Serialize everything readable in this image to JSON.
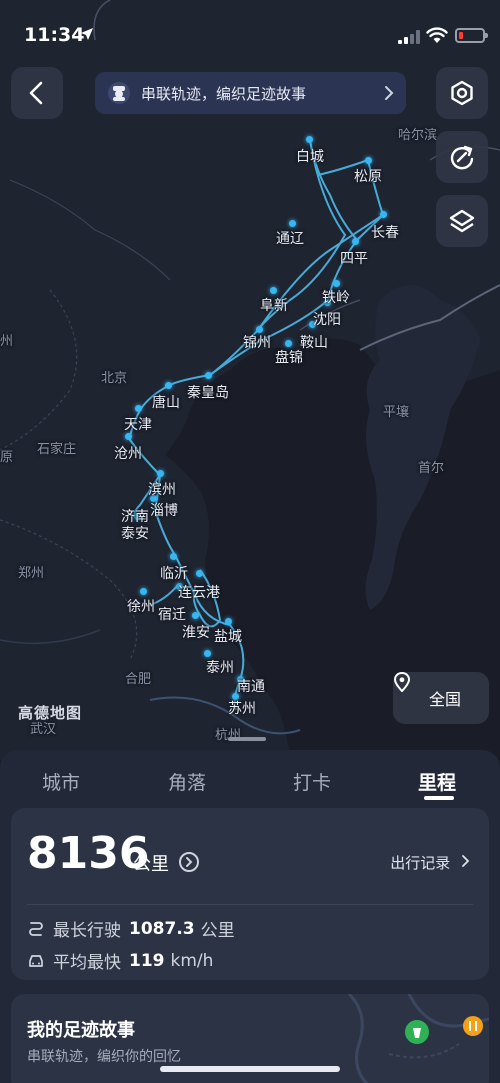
{
  "status_bar": {
    "time": "11:34"
  },
  "top": {
    "story_banner": "串联轨迹，编织足迹故事"
  },
  "map": {
    "watermark": "高德地图",
    "whole_country_label": "全国",
    "visited_cities": [
      "白城",
      "松原",
      "长春",
      "通辽",
      "四平",
      "铁岭",
      "阜新",
      "沈阳",
      "锦州",
      "鞍山",
      "盘锦",
      "秦皇岛",
      "唐山",
      "天津",
      "沧州",
      "滨州",
      "淄博",
      "济南",
      "泰安",
      "临沂",
      "连云港",
      "徐州",
      "宿迁",
      "淮安",
      "盐城",
      "泰州",
      "南通",
      "苏州"
    ],
    "other_labels": [
      "哈尔滨",
      "北京",
      "石家庄",
      "平壤",
      "首尔",
      "郑州",
      "合肥",
      "杭州",
      "武汉",
      "原",
      "州"
    ]
  },
  "panel": {
    "tabs": [
      {
        "label": "城市",
        "active": false
      },
      {
        "label": "角落",
        "active": false
      },
      {
        "label": "打卡",
        "active": false
      },
      {
        "label": "里程",
        "active": true
      }
    ],
    "mileage": {
      "total": "8136",
      "unit": "公里",
      "trip_record_label": "出行记录",
      "longest_label": "最长行驶",
      "longest_value": "1087.3",
      "longest_unit": "公里",
      "avg_fastest_label": "平均最快",
      "avg_fastest_value": "119",
      "avg_fastest_unit": "km/h"
    },
    "story": {
      "title": "我的足迹故事",
      "subtitle": "串联轨迹，编织你的回忆"
    }
  }
}
